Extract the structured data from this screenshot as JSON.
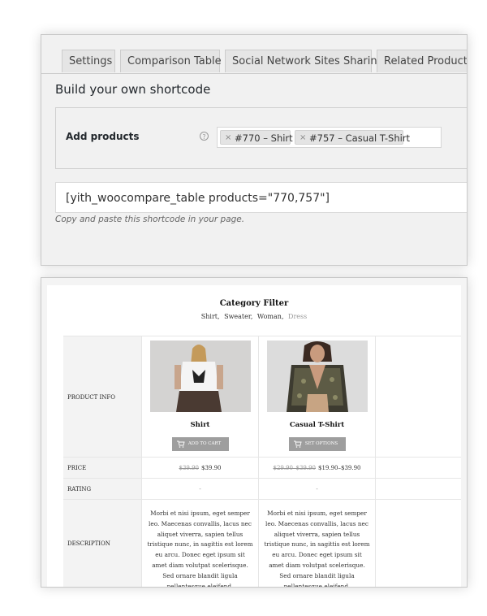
{
  "tabs": [
    "Settings",
    "Comparison Table",
    "Social Network Sites Sharing",
    "Related Products"
  ],
  "build_title": "Build your own shortcode",
  "add_products": {
    "label": "Add products",
    "help": "?",
    "selected": [
      {
        "remove": "×",
        "text": "#770 – Shirt"
      },
      {
        "remove": "×",
        "text": "#757 – Casual T-Shirt"
      }
    ]
  },
  "shortcode": "[yith_woocompare_table products=\"770,757\"]",
  "hint": "Copy and paste this shortcode in your page.",
  "compare": {
    "filter_title": "Category Filter",
    "categories": [
      "Shirt",
      "Sweater",
      "Woman",
      "Dress"
    ],
    "separator": ",",
    "labels": {
      "product_info": "PRODUCT INFO",
      "price": "PRICE",
      "rating": "RATING",
      "description": "DESCRIPTION"
    },
    "products": [
      {
        "name": "Shirt",
        "button": "ADD TO CART",
        "price_old": "$39.90",
        "price_new": "$39.90",
        "rating": "-",
        "description": "Morbi et nisi ipsum, eget semper leo. Maecenas convallis, lacus nec aliquet viverra, sapien tellus tristique nunc, in sagittis est lorem eu arcu. Donec eget ipsum sit amet diam volutpat scelerisque. Sed ornare blandit ligula pellentesque eleifend."
      },
      {
        "name": "Casual T-Shirt",
        "button": "SET OPTIONS",
        "price_old": "$29.90–$39.90",
        "price_new": "$19.90–$39.90",
        "rating": "-",
        "description": "Morbi et nisi ipsum, eget semper leo. Maecenas convallis, lacus nec aliquet viverra, sapien tellus tristique nunc, in sagittis est lorem eu arcu. Donec eget ipsum sit amet diam volutpat scelerisque. Sed ornare blandit ligula pellentesque eleifend."
      }
    ]
  },
  "colors": {
    "panel_bg": "#f1f1f1",
    "button_gray": "#9e9e9e",
    "label_column": "#f3f3f3"
  }
}
